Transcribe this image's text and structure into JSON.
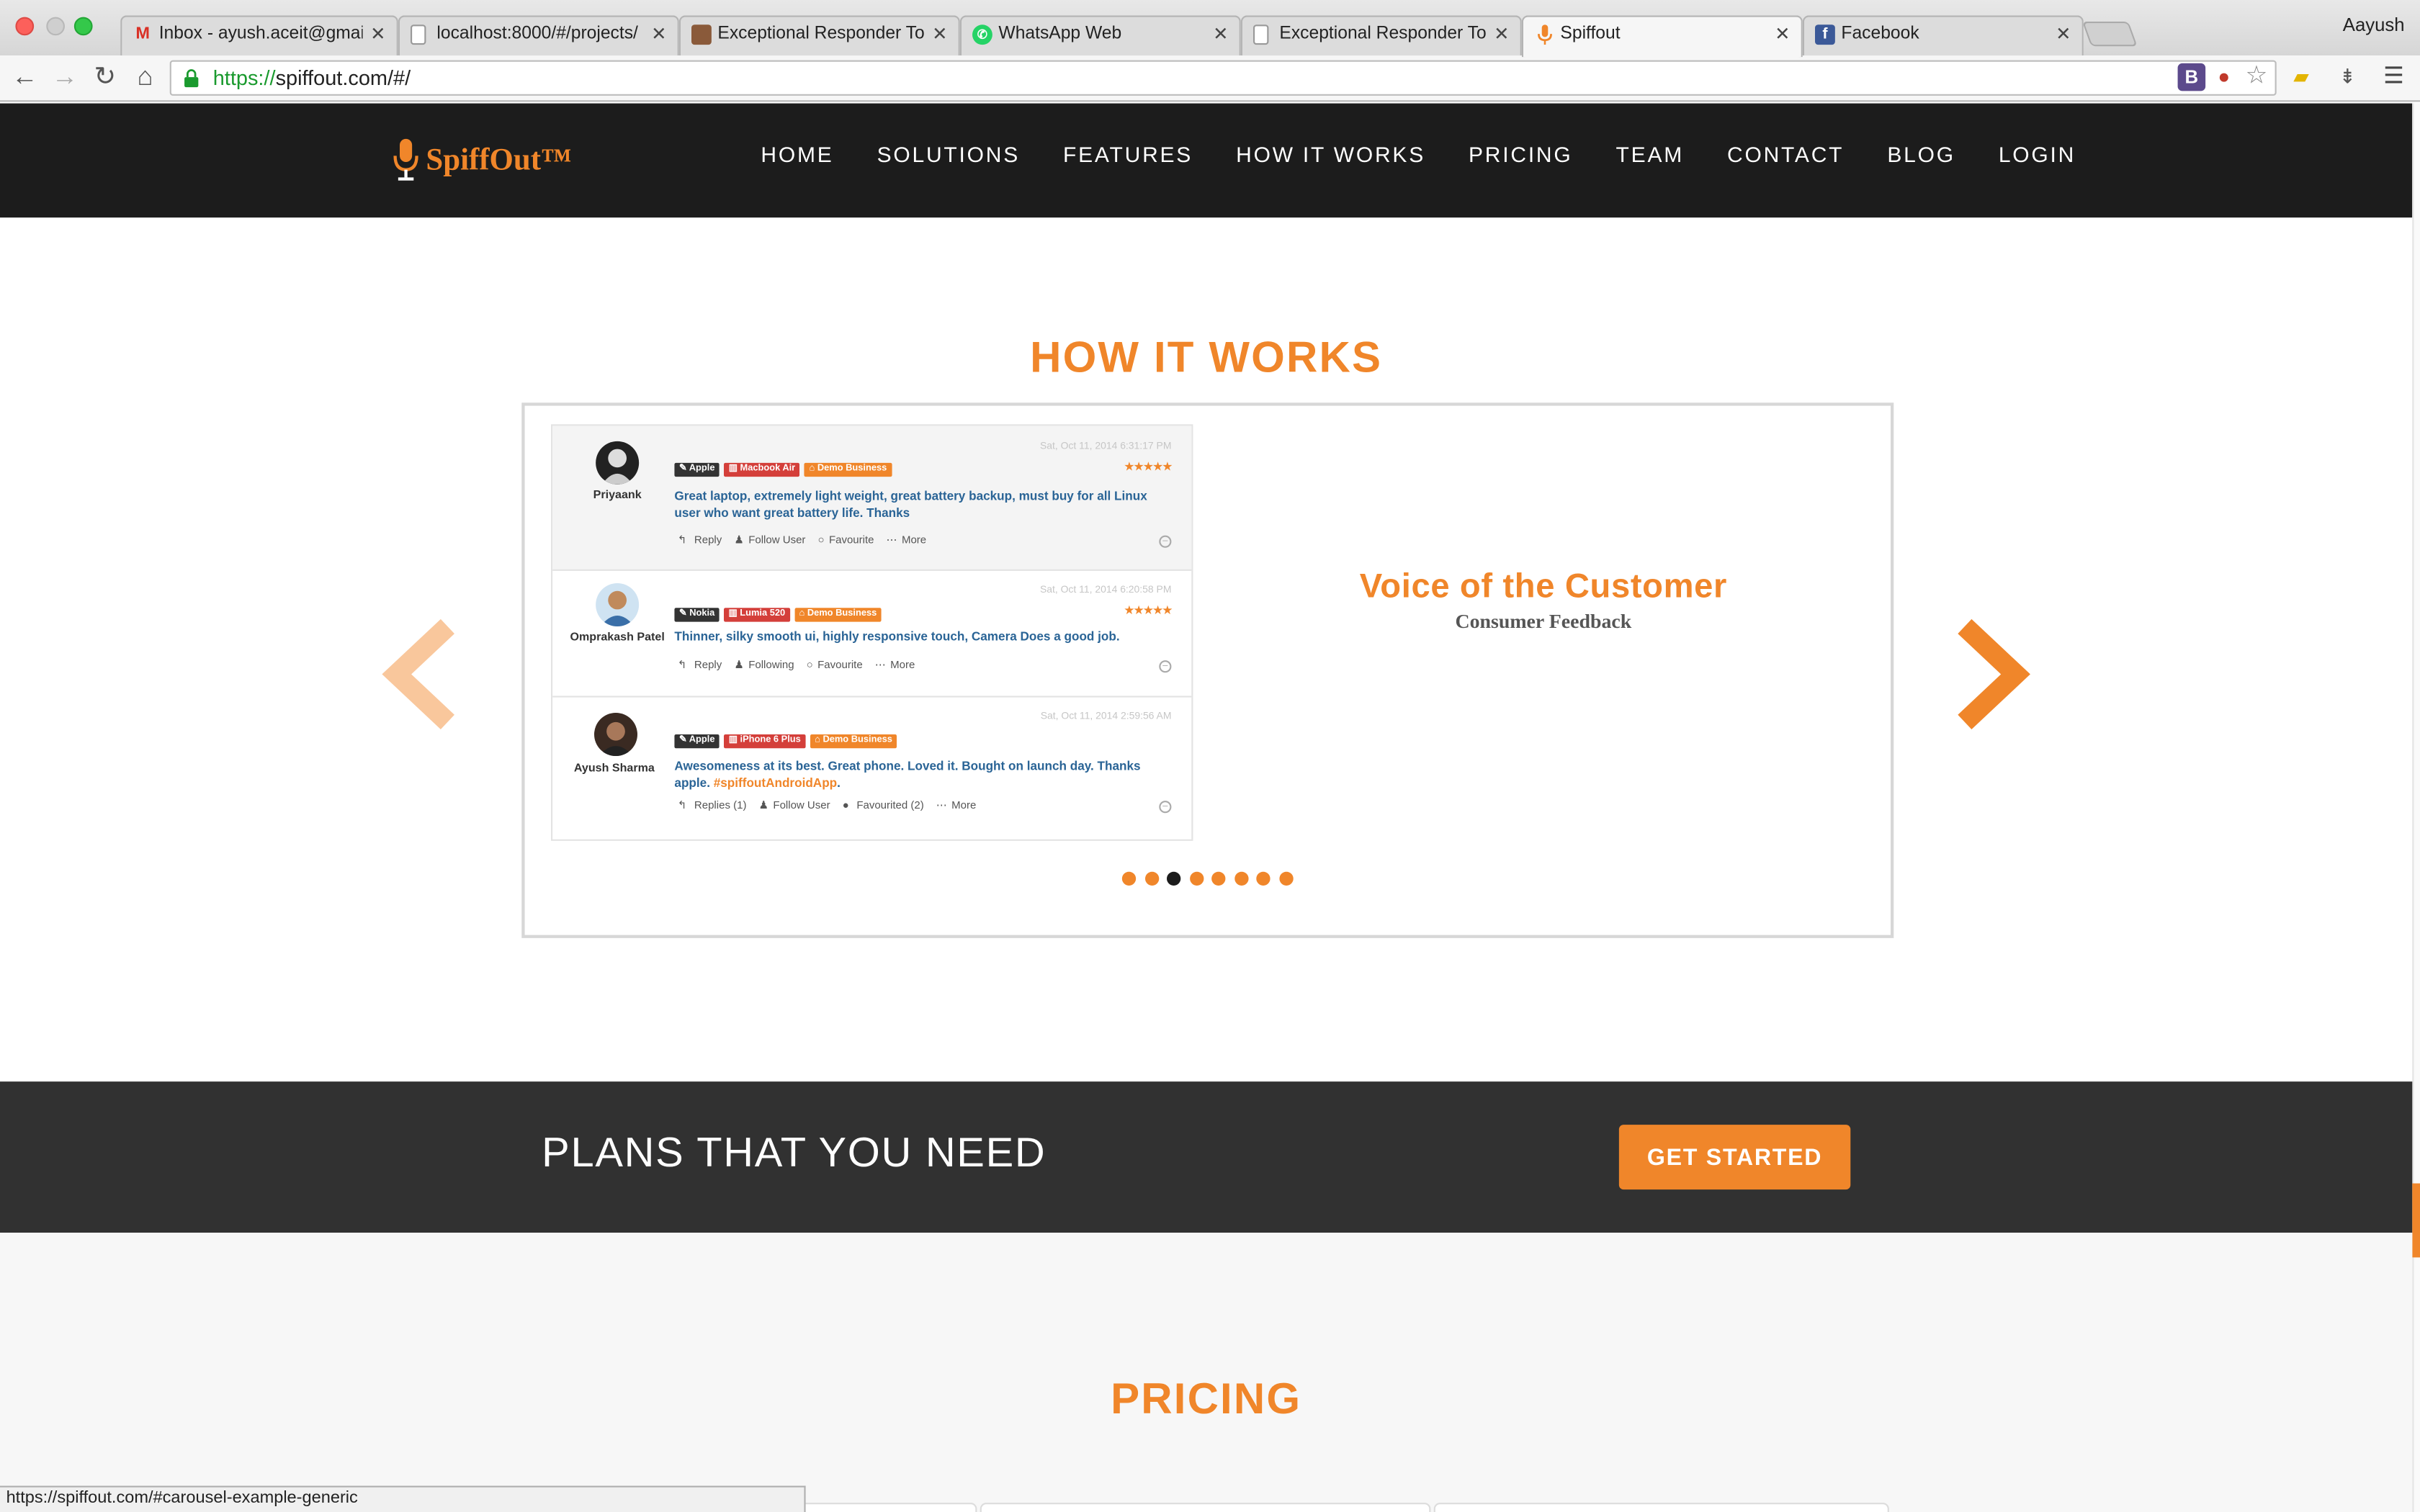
{
  "browser": {
    "tabs": [
      {
        "title": "Inbox - ayush.aceit@gmail.",
        "icon": "gmail-icon"
      },
      {
        "title": "localhost:8000/#/projects/",
        "icon": "page-icon"
      },
      {
        "title": "Exceptional Responder Too",
        "icon": "image-icon"
      },
      {
        "title": "WhatsApp Web",
        "icon": "whatsapp-icon"
      },
      {
        "title": "Exceptional Responder Too",
        "icon": "page-icon"
      },
      {
        "title": "Spiffout",
        "icon": "spiffout-mic-icon"
      },
      {
        "title": "Facebook",
        "icon": "facebook-icon"
      }
    ],
    "active_tab": 5,
    "profile_name": "Aayush",
    "url_scheme": "https://",
    "url_rest": "spiffout.com/#/",
    "status_url": "https://spiffout.com/#carousel-example-generic"
  },
  "site": {
    "logo_text": "SpiffOut™",
    "nav": [
      "HOME",
      "SOLUTIONS",
      "FEATURES",
      "HOW IT WORKS",
      "PRICING",
      "TEAM",
      "CONTACT",
      "BLOG",
      "LOGIN"
    ],
    "how_title": "HOW IT WORKS",
    "slide_title": "Voice of the Customer",
    "slide_subtitle": "Consumer Feedback",
    "carousel_dots": 8,
    "carousel_active_dot": 2,
    "plans_text": "PLANS THAT YOU NEED",
    "get_started": "GET STARTED",
    "pricing_title": "PRICING"
  },
  "feed": {
    "posts": [
      {
        "user": "Priyaank",
        "date": "Sat, Oct 11, 2014 6:31:17 PM",
        "tags": [
          "Apple",
          "Macbook Air",
          "Demo Business"
        ],
        "rating": 5,
        "text": "Great laptop, extremely light weight, great battery backup, must buy for all Linux user who want great battery life. Thanks",
        "hashtag": "",
        "actions": [
          "Reply",
          "Follow User",
          "Favourite",
          "More"
        ]
      },
      {
        "user": "Omprakash Patel",
        "date": "Sat, Oct 11, 2014 6:20:58 PM",
        "tags": [
          "Nokia",
          "Lumia 520",
          "Demo Business"
        ],
        "rating": 5,
        "text": "Thinner, silky smooth ui, highly responsive touch, Camera Does a good job.",
        "hashtag": "",
        "actions": [
          "Reply",
          "Following",
          "Favourite",
          "More"
        ]
      },
      {
        "user": "Ayush Sharma",
        "date": "Sat, Oct 11, 2014 2:59:56 AM",
        "tags": [
          "Apple",
          "iPhone 6 Plus",
          "Demo Business"
        ],
        "rating": 0,
        "text": "Awesomeness at its best. Great phone. Loved it. Bought on launch day. Thanks apple. ",
        "hashtag": "#spiffoutAndroidApp",
        "text_end": ".",
        "actions": [
          "Replies (1)",
          "Follow User",
          "Favourited (2)",
          "More"
        ]
      }
    ]
  },
  "colors": {
    "brand_orange": "#f0862a",
    "nav_dark": "#1c1c1c",
    "plans_band": "#313131",
    "review_text_blue": "#2a6496"
  }
}
